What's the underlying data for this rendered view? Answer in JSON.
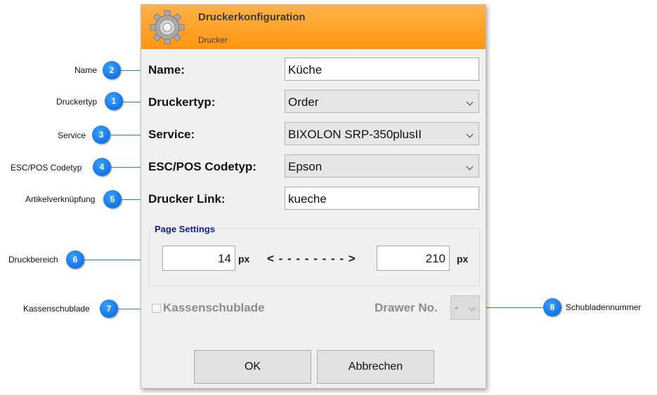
{
  "dialog": {
    "title": "Druckerkonfiguration",
    "subtitle": "Drucker",
    "header_gradient": [
      "#ffb14a",
      "#ff9610"
    ],
    "header_icon": "gear-icon"
  },
  "form": {
    "name_label": "Name:",
    "name_value": "Küche",
    "printer_type_label": "Druckertyp:",
    "printer_type_value": "Order",
    "service_label": "Service:",
    "service_value": "BIXOLON SRP-350plusII",
    "codetype_label": "ESC/POS Codetyp:",
    "codetype_value": "Epson",
    "link_label": "Drucker Link:",
    "link_value": "kueche"
  },
  "page_settings": {
    "legend": "Page Settings",
    "from_value": "14",
    "to_value": "210",
    "unit": "px",
    "arrow": "< - - - - - - - - >"
  },
  "cash_drawer": {
    "checkbox_label": "Kassenschublade",
    "checked": false,
    "drawer_no_label": "Drawer No.",
    "drawer_no_value": "-"
  },
  "buttons": {
    "ok": "OK",
    "cancel": "Abbrechen"
  },
  "callouts": [
    {
      "number": "2",
      "text": "Name"
    },
    {
      "number": "1",
      "text": "Druckertyp"
    },
    {
      "number": "3",
      "text": "Service"
    },
    {
      "number": "4",
      "text": "ESC/POS Codetyp"
    },
    {
      "number": "5",
      "text": "Artikelverknüpfung"
    },
    {
      "number": "6",
      "text": "Druckbereich"
    },
    {
      "number": "7",
      "text": "Kassenschublade"
    },
    {
      "number": "8",
      "text": "Schubladennummer"
    }
  ],
  "colors": {
    "callout": "#0a74f0",
    "legend": "#0b1f8f",
    "dialog_bg": "#f0f0f0"
  }
}
